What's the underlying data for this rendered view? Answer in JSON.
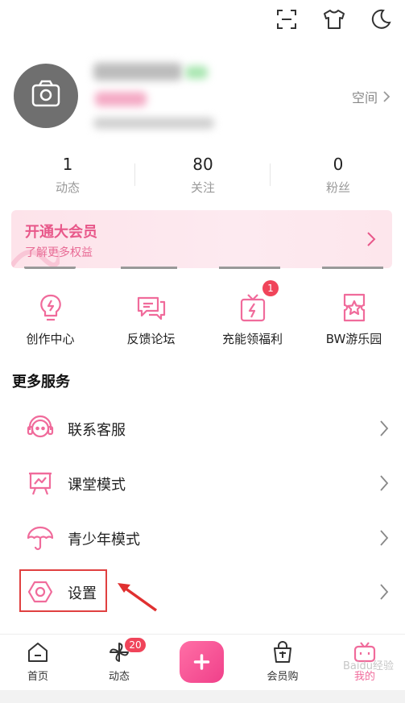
{
  "header": {
    "icons": [
      "scan-icon",
      "shirt-icon",
      "moon-icon"
    ]
  },
  "profile": {
    "space_label": "空间"
  },
  "stats": [
    {
      "value": "1",
      "label": "动态"
    },
    {
      "value": "80",
      "label": "关注"
    },
    {
      "value": "0",
      "label": "粉丝"
    }
  ],
  "vip": {
    "title": "开通大会员",
    "subtitle": "了解更多权益"
  },
  "grid": [
    {
      "label": "创作中心",
      "icon": "bulb-icon"
    },
    {
      "label": "反馈论坛",
      "icon": "chat-icon"
    },
    {
      "label": "充能领福利",
      "icon": "gift-bolt-icon",
      "badge": "1"
    },
    {
      "label": "BW游乐园",
      "icon": "ticket-star-icon"
    }
  ],
  "more_services": {
    "title": "更多服务",
    "items": [
      {
        "label": "联系客服",
        "icon": "headset-icon"
      },
      {
        "label": "课堂模式",
        "icon": "classroom-icon"
      },
      {
        "label": "青少年模式",
        "icon": "umbrella-icon"
      },
      {
        "label": "设置",
        "icon": "gear-icon"
      }
    ]
  },
  "tabs": [
    {
      "label": "首页",
      "icon": "home-icon"
    },
    {
      "label": "动态",
      "icon": "pinwheel-icon",
      "badge": "20"
    },
    {
      "label": "会员购",
      "icon": "shopping-bag-icon"
    },
    {
      "label": "我的",
      "icon": "tv-icon"
    }
  ],
  "colors": {
    "accent": "#e8588a",
    "icon_pink": "#f06b9b",
    "badge": "#f0445a",
    "highlight": "#e04040"
  },
  "watermark": "Baidu经验"
}
